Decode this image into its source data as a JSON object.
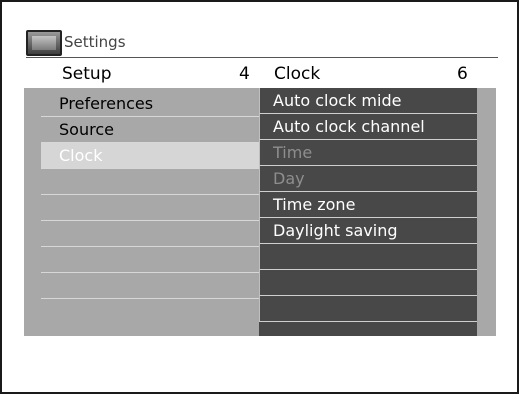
{
  "header": {
    "title": "Settings",
    "left_label": "Setup",
    "left_count": "4",
    "right_label": "Clock",
    "right_count": "6"
  },
  "left_menu": [
    {
      "label": "Preferences",
      "selected": false
    },
    {
      "label": "Source",
      "selected": false
    },
    {
      "label": "Clock",
      "selected": true
    },
    {
      "label": "",
      "selected": false
    },
    {
      "label": "",
      "selected": false
    },
    {
      "label": "",
      "selected": false
    },
    {
      "label": "",
      "selected": false
    },
    {
      "label": "",
      "selected": false
    }
  ],
  "right_menu": [
    {
      "label": "Auto clock mide",
      "enabled": true
    },
    {
      "label": "Auto clock channel",
      "enabled": true
    },
    {
      "label": "Time",
      "enabled": false
    },
    {
      "label": "Day",
      "enabled": false
    },
    {
      "label": "Time zone",
      "enabled": true
    },
    {
      "label": "Daylight saving",
      "enabled": true
    },
    {
      "label": "",
      "enabled": true
    },
    {
      "label": "",
      "enabled": true
    },
    {
      "label": "",
      "enabled": true
    }
  ],
  "icon": {
    "name": "tv-icon"
  },
  "colors": {
    "panel": "#a8a8a8",
    "right_column": "#484848",
    "selected_row": "#d6d6d6",
    "disabled_text": "#8e8e8e"
  }
}
